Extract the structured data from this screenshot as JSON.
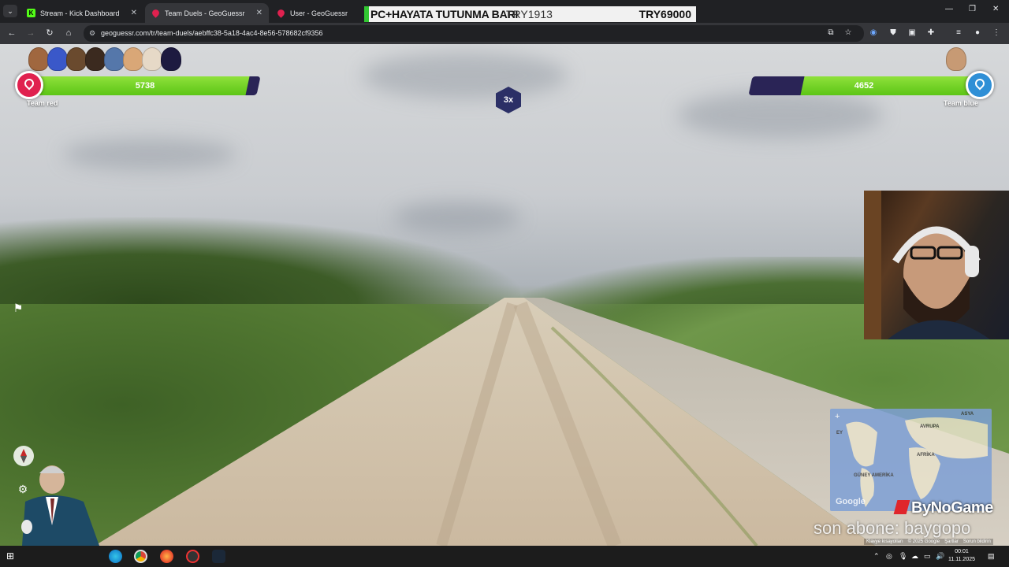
{
  "tabs": [
    {
      "title": "Stream - Kick Dashboard",
      "favicon": "kick-icon",
      "active": false
    },
    {
      "title": "Team Duels - GeoGuessr",
      "favicon": "geoguessr-icon",
      "active": true
    },
    {
      "title": "User - GeoGuessr",
      "favicon": "geoguessr-icon",
      "active": false
    }
  ],
  "banner": {
    "left": "PC+HAYATA TUTUNMA BARI",
    "middle": "TRY1913",
    "right": "TRY69000"
  },
  "address": {
    "url": "geoguessr.com/tr/team-duels/aebffc38-5a18-4ac4-8e56-578682cf9356"
  },
  "game": {
    "team_red": {
      "label": "Team red",
      "health": "5738",
      "health_fraction": 0.95,
      "color": "#e0214f"
    },
    "team_blue": {
      "label": "Team blue",
      "health": "4652",
      "health_fraction": 0.77,
      "color": "#2f8fd6"
    },
    "multiplier": "3x"
  },
  "minimap": {
    "labels": {
      "asia": "ASYA",
      "europe": "AVRUPA",
      "africa": "AFRİKA",
      "s_america": "GÜNEY AMERİKA",
      "n_america": "EY"
    }
  },
  "overlays": {
    "sponsor": "ByNoGame",
    "subscriber": "son abone: baygopo",
    "google": "Google"
  },
  "attribution": [
    "Klavye kısayolları",
    "© 2025 Google",
    "Şartlar",
    "Sorun bildirin"
  ],
  "taskbar": {
    "time": "00:01",
    "date": "11.11.2025"
  }
}
